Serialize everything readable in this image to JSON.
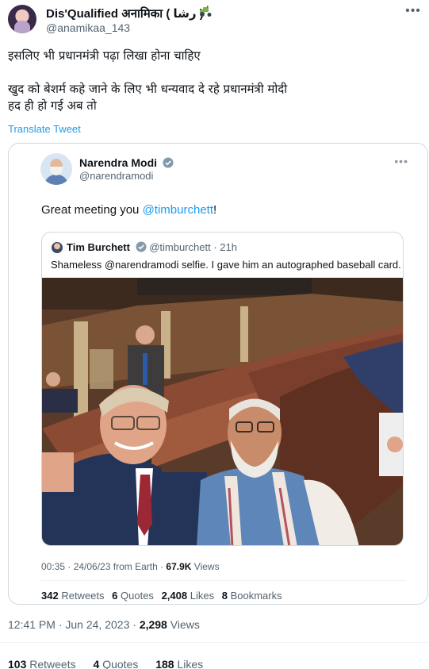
{
  "author": {
    "display_name": "Dis'Qualified अनामिका ( رشا )",
    "handle": "@anamikaa_143",
    "badge_icon": "tractor-icon"
  },
  "tweet": {
    "line1": "इसलिए भी प्रधानमंत्री पढ़ा लिखा होना चाहिए",
    "line2": "खुद को बेशर्म कहे जाने के लिए भी धन्यवाद दे रहे प्रधानमंत्री मोदी",
    "line3": "हद ही हो गई अब तो",
    "translate_label": "Translate Tweet",
    "timestamp_time": "12:41 PM",
    "timestamp_sep": " · ",
    "timestamp_date": "Jun 24, 2023",
    "views_count": "2,298",
    "views_label": "Views",
    "retweets_count": "103",
    "retweets_label": "Retweets",
    "quotes_count": "4",
    "quotes_label": "Quotes",
    "likes_count": "188",
    "likes_label": "Likes"
  },
  "quoted": {
    "display_name": "Narendra Modi",
    "handle": "@narendramodi",
    "text_prefix": "Great meeting you ",
    "mention": "@timburchett",
    "text_suffix": "!",
    "meta_time": "00:35 · 24/06/23 from Earth · ",
    "meta_views": "67.9K",
    "meta_views_label": "Views",
    "retweets_count": "342",
    "retweets_label": "Retweets",
    "quotes_count": "6",
    "quotes_label": "Quotes",
    "likes_count": "2,408",
    "likes_label": "Likes",
    "bookmarks_count": "8",
    "bookmarks_label": "Bookmarks"
  },
  "inner_quote": {
    "display_name": "Tim Burchett",
    "handle": "@timburchett",
    "age": "· 21h",
    "text": "Shameless @narendramodi selfie. I gave him an autographed baseball card."
  },
  "colors": {
    "accent": "#1d9bf0",
    "secondary_text": "#536471",
    "border": "#cfd9de"
  }
}
